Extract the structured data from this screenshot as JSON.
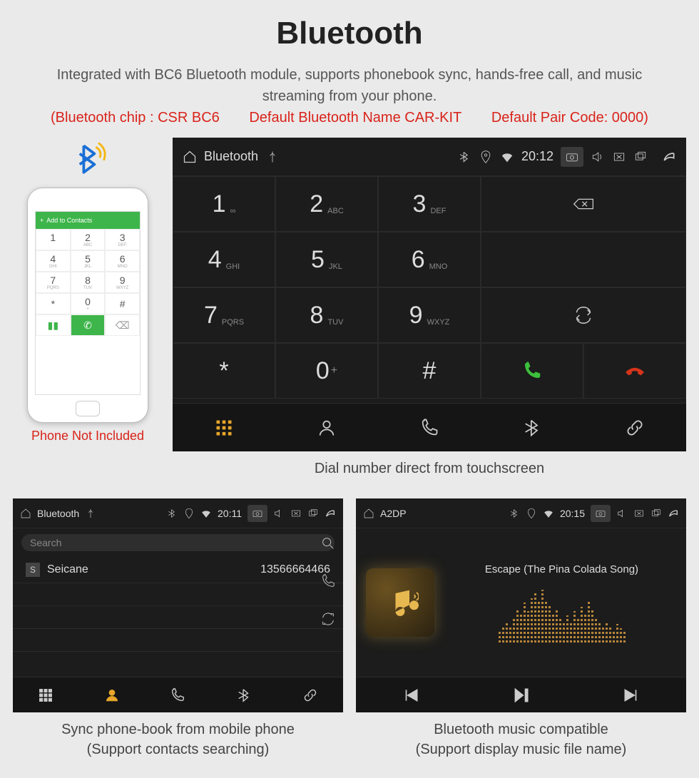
{
  "title": "Bluetooth",
  "subtitle": "Integrated with BC6 Bluetooth module, supports phonebook sync, hands-free call, and music streaming from your phone.",
  "spec": {
    "chip": "(Bluetooth chip : CSR BC6",
    "name": "Default Bluetooth Name CAR-KIT",
    "code": "Default Pair Code: 0000)"
  },
  "phone_caption": "Phone Not Included",
  "phone_topbar": "Add to Contacts",
  "dialer": {
    "status_label": "Bluetooth",
    "time": "20:12",
    "keys": [
      {
        "digit": "1",
        "sub": "∞"
      },
      {
        "digit": "2",
        "sub": "ABC"
      },
      {
        "digit": "3",
        "sub": "DEF"
      },
      {
        "digit": "4",
        "sub": "GHI"
      },
      {
        "digit": "5",
        "sub": "JKL"
      },
      {
        "digit": "6",
        "sub": "MNO"
      },
      {
        "digit": "7",
        "sub": "PQRS"
      },
      {
        "digit": "8",
        "sub": "TUV"
      },
      {
        "digit": "9",
        "sub": "WXYZ"
      },
      {
        "digit": "*",
        "sub": ""
      },
      {
        "digit": "0",
        "sub": "+"
      },
      {
        "digit": "#",
        "sub": ""
      }
    ],
    "caption": "Dial number direct from touchscreen"
  },
  "contacts": {
    "status_label": "Bluetooth",
    "time": "20:11",
    "search_placeholder": "Search",
    "entry_badge": "S",
    "entry_name": "Seicane",
    "entry_number": "13566664466",
    "caption_line1": "Sync phone-book from mobile phone",
    "caption_line2": "(Support contacts searching)"
  },
  "music": {
    "status_label": "A2DP",
    "time": "20:15",
    "track": "Escape (The Pina Colada Song)",
    "caption_line1": "Bluetooth music compatible",
    "caption_line2": "(Support display music file name)"
  }
}
